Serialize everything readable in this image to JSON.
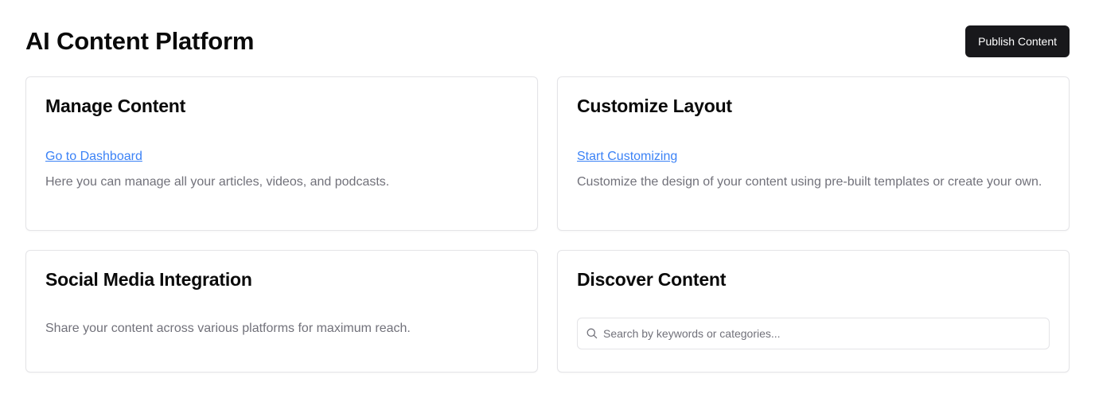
{
  "header": {
    "title": "AI Content Platform",
    "publish_label": "Publish Content"
  },
  "cards": {
    "manage": {
      "title": "Manage Content",
      "link": "Go to Dashboard",
      "description": "Here you can manage all your articles, videos, and podcasts."
    },
    "customize": {
      "title": "Customize Layout",
      "link": "Start Customizing",
      "description": "Customize the design of your content using pre-built templates or create your own."
    },
    "social": {
      "title": "Social Media Integration",
      "description": "Share your content across various platforms for maximum reach."
    },
    "discover": {
      "title": "Discover Content",
      "search_placeholder": "Search by keywords or categories...",
      "search_value": "",
      "search_icon": "search-icon"
    }
  },
  "colors": {
    "primary_button": "#18181b",
    "link": "#3b82f6",
    "muted_text": "#71717a",
    "border": "#e4e4e7"
  }
}
